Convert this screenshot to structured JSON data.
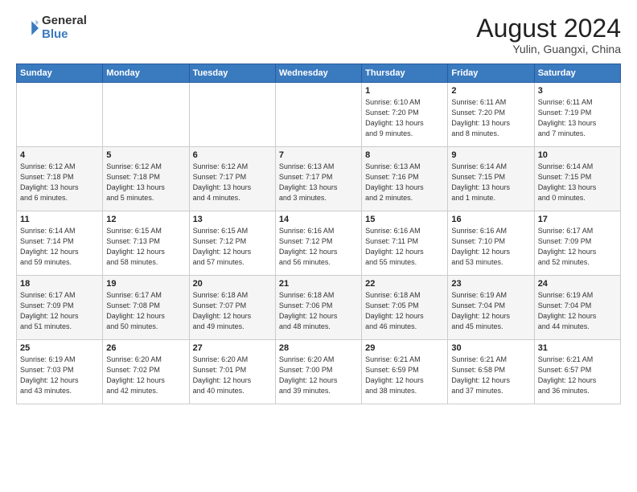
{
  "header": {
    "logo_general": "General",
    "logo_blue": "Blue",
    "month": "August 2024",
    "location": "Yulin, Guangxi, China"
  },
  "weekdays": [
    "Sunday",
    "Monday",
    "Tuesday",
    "Wednesday",
    "Thursday",
    "Friday",
    "Saturday"
  ],
  "weeks": [
    [
      {
        "day": "",
        "info": ""
      },
      {
        "day": "",
        "info": ""
      },
      {
        "day": "",
        "info": ""
      },
      {
        "day": "",
        "info": ""
      },
      {
        "day": "1",
        "info": "Sunrise: 6:10 AM\nSunset: 7:20 PM\nDaylight: 13 hours\nand 9 minutes."
      },
      {
        "day": "2",
        "info": "Sunrise: 6:11 AM\nSunset: 7:20 PM\nDaylight: 13 hours\nand 8 minutes."
      },
      {
        "day": "3",
        "info": "Sunrise: 6:11 AM\nSunset: 7:19 PM\nDaylight: 13 hours\nand 7 minutes."
      }
    ],
    [
      {
        "day": "4",
        "info": "Sunrise: 6:12 AM\nSunset: 7:18 PM\nDaylight: 13 hours\nand 6 minutes."
      },
      {
        "day": "5",
        "info": "Sunrise: 6:12 AM\nSunset: 7:18 PM\nDaylight: 13 hours\nand 5 minutes."
      },
      {
        "day": "6",
        "info": "Sunrise: 6:12 AM\nSunset: 7:17 PM\nDaylight: 13 hours\nand 4 minutes."
      },
      {
        "day": "7",
        "info": "Sunrise: 6:13 AM\nSunset: 7:17 PM\nDaylight: 13 hours\nand 3 minutes."
      },
      {
        "day": "8",
        "info": "Sunrise: 6:13 AM\nSunset: 7:16 PM\nDaylight: 13 hours\nand 2 minutes."
      },
      {
        "day": "9",
        "info": "Sunrise: 6:14 AM\nSunset: 7:15 PM\nDaylight: 13 hours\nand 1 minute."
      },
      {
        "day": "10",
        "info": "Sunrise: 6:14 AM\nSunset: 7:15 PM\nDaylight: 13 hours\nand 0 minutes."
      }
    ],
    [
      {
        "day": "11",
        "info": "Sunrise: 6:14 AM\nSunset: 7:14 PM\nDaylight: 12 hours\nand 59 minutes."
      },
      {
        "day": "12",
        "info": "Sunrise: 6:15 AM\nSunset: 7:13 PM\nDaylight: 12 hours\nand 58 minutes."
      },
      {
        "day": "13",
        "info": "Sunrise: 6:15 AM\nSunset: 7:12 PM\nDaylight: 12 hours\nand 57 minutes."
      },
      {
        "day": "14",
        "info": "Sunrise: 6:16 AM\nSunset: 7:12 PM\nDaylight: 12 hours\nand 56 minutes."
      },
      {
        "day": "15",
        "info": "Sunrise: 6:16 AM\nSunset: 7:11 PM\nDaylight: 12 hours\nand 55 minutes."
      },
      {
        "day": "16",
        "info": "Sunrise: 6:16 AM\nSunset: 7:10 PM\nDaylight: 12 hours\nand 53 minutes."
      },
      {
        "day": "17",
        "info": "Sunrise: 6:17 AM\nSunset: 7:09 PM\nDaylight: 12 hours\nand 52 minutes."
      }
    ],
    [
      {
        "day": "18",
        "info": "Sunrise: 6:17 AM\nSunset: 7:09 PM\nDaylight: 12 hours\nand 51 minutes."
      },
      {
        "day": "19",
        "info": "Sunrise: 6:17 AM\nSunset: 7:08 PM\nDaylight: 12 hours\nand 50 minutes."
      },
      {
        "day": "20",
        "info": "Sunrise: 6:18 AM\nSunset: 7:07 PM\nDaylight: 12 hours\nand 49 minutes."
      },
      {
        "day": "21",
        "info": "Sunrise: 6:18 AM\nSunset: 7:06 PM\nDaylight: 12 hours\nand 48 minutes."
      },
      {
        "day": "22",
        "info": "Sunrise: 6:18 AM\nSunset: 7:05 PM\nDaylight: 12 hours\nand 46 minutes."
      },
      {
        "day": "23",
        "info": "Sunrise: 6:19 AM\nSunset: 7:04 PM\nDaylight: 12 hours\nand 45 minutes."
      },
      {
        "day": "24",
        "info": "Sunrise: 6:19 AM\nSunset: 7:04 PM\nDaylight: 12 hours\nand 44 minutes."
      }
    ],
    [
      {
        "day": "25",
        "info": "Sunrise: 6:19 AM\nSunset: 7:03 PM\nDaylight: 12 hours\nand 43 minutes."
      },
      {
        "day": "26",
        "info": "Sunrise: 6:20 AM\nSunset: 7:02 PM\nDaylight: 12 hours\nand 42 minutes."
      },
      {
        "day": "27",
        "info": "Sunrise: 6:20 AM\nSunset: 7:01 PM\nDaylight: 12 hours\nand 40 minutes."
      },
      {
        "day": "28",
        "info": "Sunrise: 6:20 AM\nSunset: 7:00 PM\nDaylight: 12 hours\nand 39 minutes."
      },
      {
        "day": "29",
        "info": "Sunrise: 6:21 AM\nSunset: 6:59 PM\nDaylight: 12 hours\nand 38 minutes."
      },
      {
        "day": "30",
        "info": "Sunrise: 6:21 AM\nSunset: 6:58 PM\nDaylight: 12 hours\nand 37 minutes."
      },
      {
        "day": "31",
        "info": "Sunrise: 6:21 AM\nSunset: 6:57 PM\nDaylight: 12 hours\nand 36 minutes."
      }
    ]
  ]
}
